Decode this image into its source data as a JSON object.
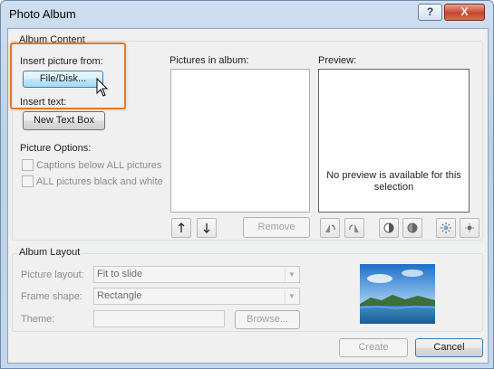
{
  "window": {
    "title": "Photo Album",
    "help_label": "?",
    "close_label": "X"
  },
  "album_content": {
    "group_label": "Album Content",
    "insert_picture_label": "Insert picture from:",
    "file_disk_button": "File/Disk...",
    "insert_text_label": "Insert text:",
    "new_text_box_button": "New Text Box",
    "picture_options_label": "Picture Options:",
    "captions_checkbox": {
      "label": "Captions below ALL pictures",
      "checked": false,
      "enabled": false
    },
    "black_white_checkbox": {
      "label": "ALL pictures black and white",
      "checked": false,
      "enabled": false
    },
    "pictures_in_album_label": "Pictures in album:",
    "remove_button": "Remove",
    "preview_label": "Preview:",
    "preview_message": "No preview is available for this selection",
    "icons": [
      "move-up-icon",
      "move-down-icon",
      "rotate-left-icon",
      "rotate-right-icon",
      "contrast-up-icon",
      "contrast-down-icon",
      "brightness-up-icon",
      "brightness-down-icon"
    ]
  },
  "album_layout": {
    "group_label": "Album Layout",
    "picture_layout_label": "Picture layout:",
    "picture_layout_value": "Fit to slide",
    "frame_shape_label": "Frame shape:",
    "frame_shape_value": "Rectangle",
    "theme_label": "Theme:",
    "theme_value": "",
    "browse_button": "Browse..."
  },
  "footer": {
    "create_button": "Create",
    "cancel_button": "Cancel"
  },
  "colors": {
    "highlight": "#e07b2a",
    "title_gradient": "#c4d7ec",
    "close_button": "#c6462b"
  }
}
